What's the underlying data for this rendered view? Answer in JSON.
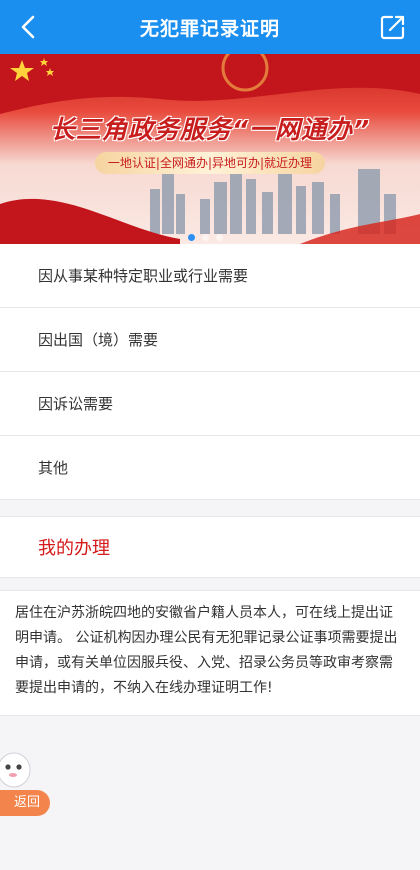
{
  "header": {
    "title": "无犯罪记录证明",
    "back_icon": "chevron-left-icon",
    "share_icon": "edit-share-icon",
    "bg_color": "#1a8ff0"
  },
  "banner": {
    "slogan": "长三角政务服务“一网通办”",
    "subtitle": "一地认证|全网通办|异地可办|就近办理"
  },
  "options": [
    {
      "label": "因从事某种特定职业或行业需要"
    },
    {
      "label": "因出国（境）需要"
    },
    {
      "label": "因诉讼需要"
    },
    {
      "label": "其他"
    }
  ],
  "my_handling": {
    "label": "我的办理",
    "color": "#d41a1a"
  },
  "notice": {
    "text": "居住在沪苏浙皖四地的安徽省户籍人员本人，可在线上提出证明申请。 公证机构因办理公民有无犯罪记录公证事项需要提出申请，或有关单位因服兵役、入党、招录公务员等政审考察需要提出申请的，不纳入在线办理证明工作!"
  },
  "float": {
    "return_label": "返回",
    "return_color": "#f3844c"
  }
}
